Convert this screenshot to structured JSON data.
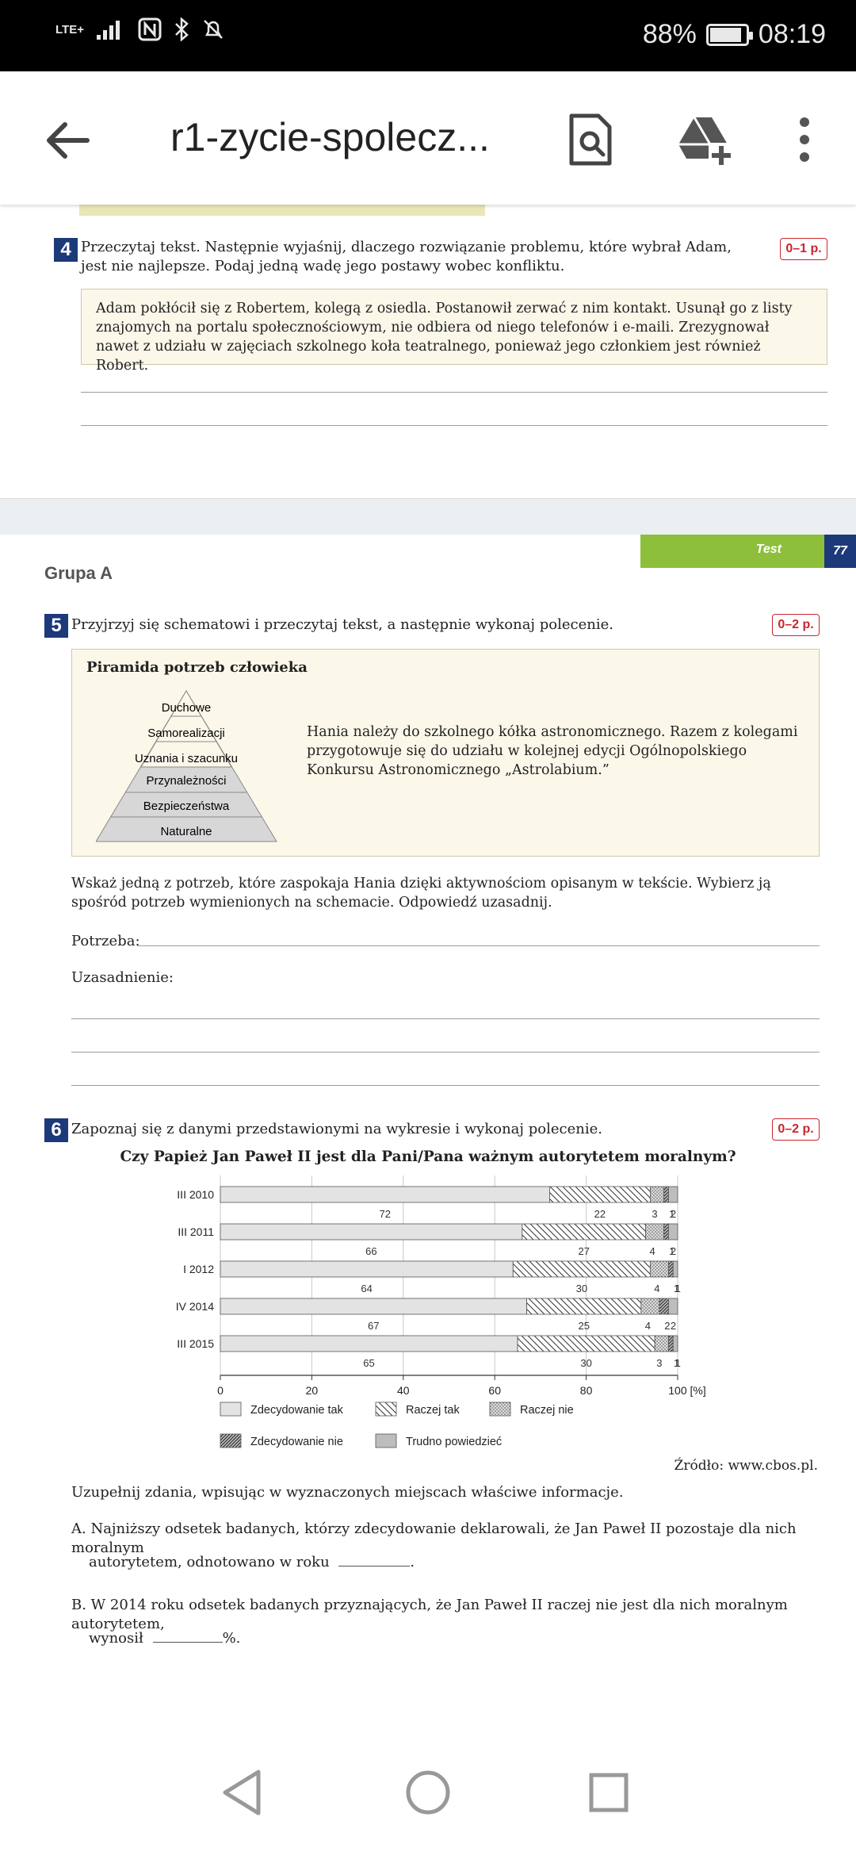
{
  "status_bar": {
    "network": "LTE+",
    "battery": "88%",
    "battery_level": 0.88,
    "time": "08:19"
  },
  "app_bar": {
    "title": "r1-zycie-spolecz..."
  },
  "q4": {
    "number": "4",
    "prompt_line1": "Przeczytaj tekst. Następnie wyjaśnij, dlaczego rozwiązanie problemu, które wybrał Adam,",
    "prompt_line2": "jest nie najlepsze. Podaj jedną wadę jego postawy wobec konfliktu.",
    "points": "0–1 p.",
    "text": "Adam pokłócił się z Robertem, kolegą z osiedla. Postanowił zerwać z nim kontakt. Usunął go z listy znajomych na portalu społecznościowym, nie odbiera od niego telefonów i e-maili. Zrezygnował nawet z udziału w zajęciach szkolnego koła teatralnego, ponieważ jego członkiem jest również Robert."
  },
  "page_header": {
    "test_label": "Test",
    "page_number": "77",
    "group": "Grupa A"
  },
  "q5": {
    "number": "5",
    "prompt": "Przyjrzyj się schematowi i przeczytaj tekst, a następnie wykonaj polecenie.",
    "points": "0–2 p.",
    "pyramid_title": "Piramida potrzeb człowieka",
    "pyramid_levels": [
      "Duchowe",
      "Samorealizacji",
      "Uznania i szacunku",
      "Przynależności",
      "Bezpieczeństwa",
      "Naturalne"
    ],
    "text": "Hania należy do szkolnego kółka astronomicznego. Razem z kolegami przygotowuje się do udziału w kolejnej edycji Ogólnopolskiego Konkursu Astronomicznego „Astrolabium.”",
    "instruction": "Wskaż jedną z potrzeb, które zaspokaja Hania dzięki aktywnościom opisanym w tekście. Wybierz ją spośród potrzeb wymienionych na schemacie. Odpowiedź uzasadnij.",
    "need_label": "Potrzeba:",
    "justification_label": "Uzasadnienie:"
  },
  "q6": {
    "number": "6",
    "prompt": "Zapoznaj się z danymi przedstawionymi na wykresie i wykonaj polecenie.",
    "points": "0–2 p.",
    "source": "Źródło: www.cbos.pl.",
    "instruction": "Uzupełnij zdania, wpisując w wyznaczonych miejscach właściwe informacje.",
    "sentence_a_line1": "A. Najniższy odsetek badanych, którzy zdecydowanie deklarowali, że Jan Paweł II pozostaje dla nich moralnym",
    "sentence_a_line2": "autorytetem, odnotowano w roku",
    "sentence_b_line1": "B. W 2014 roku odsetek badanych przyznających, że Jan Paweł II raczej nie jest dla nich moralnym autorytetem,",
    "sentence_b_line2": "wynosił",
    "sentence_b_unit": "%."
  },
  "chart_data": {
    "type": "bar",
    "orientation": "horizontal-stacked",
    "title": "Czy Papież Jan Paweł II jest dla Pani/Pana ważnym autorytetem moralnym?",
    "categories": [
      "III 2010",
      "III 2011",
      "I 2012",
      "IV 2014",
      "III 2015"
    ],
    "series": [
      {
        "name": "Zdecydowanie tak",
        "values": [
          72,
          66,
          64,
          67,
          65
        ],
        "pattern": "solid"
      },
      {
        "name": "Raczej tak",
        "values": [
          22,
          27,
          30,
          25,
          30
        ],
        "pattern": "hatch"
      },
      {
        "name": "Raczej nie",
        "values": [
          3,
          4,
          4,
          4,
          3
        ],
        "pattern": "dots"
      },
      {
        "name": "Zdecydowanie nie",
        "values": [
          1,
          1,
          1,
          2,
          1
        ],
        "pattern": "dense-hatch"
      },
      {
        "name": "Trudno powiedzieć",
        "values": [
          2,
          2,
          1,
          2,
          1
        ],
        "pattern": "gray"
      }
    ],
    "x_ticks": [
      "0",
      "20",
      "40",
      "60",
      "80",
      "100 [%]"
    ],
    "xlim": [
      0,
      100
    ],
    "grid": true,
    "legend_position": "bottom"
  }
}
